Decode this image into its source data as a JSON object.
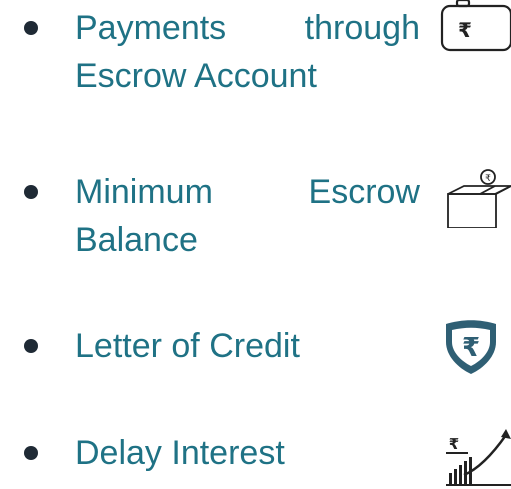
{
  "items": [
    {
      "label": "Payments through Escrow Account",
      "icon": "rupee-bag-icon"
    },
    {
      "label": "Minimum Escrow Balance",
      "icon": "coin-box-icon"
    },
    {
      "label": "Letter of Credit",
      "icon": "rupee-shield-icon"
    },
    {
      "label": "Delay Interest",
      "icon": "rupee-growth-chart-icon"
    }
  ],
  "colors": {
    "text": "#1f7285",
    "bullet": "#1f2a35",
    "icon_stroke": "#222222",
    "shield_fill": "#2f5f74"
  }
}
